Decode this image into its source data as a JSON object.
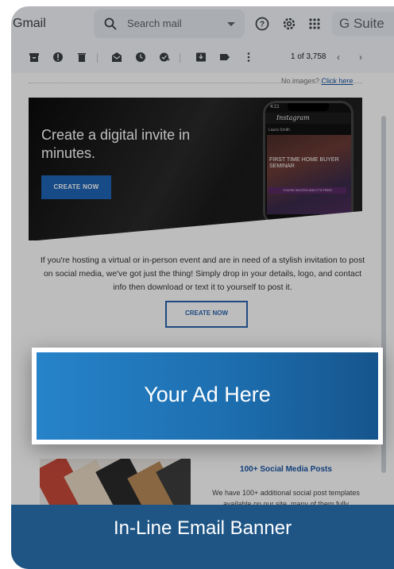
{
  "gmail": {
    "app_name": "Gmail",
    "search_placeholder": "Search mail",
    "gsuite_label": "G Suite",
    "pager": "1 of 3,758",
    "prev": "‹",
    "next": "›"
  },
  "email": {
    "no_images": "No images?",
    "click_here": "Click here",
    "hero_headline": "Create a digital invite in minutes.",
    "hero_cta": "CREATE NOW",
    "phone": {
      "time": "4:21",
      "app": "Instagram",
      "user": "Laura Smith",
      "post_title": "FIRST TIME HOME BUYER SEMINAR",
      "post_bar": "YOU'RE INVITED AND IT'S FREE!"
    },
    "paragraph": "If you're hosting a virtual or in-person event and are in need of a stylish invitation to post on social media, we've got just the thing! Simply drop in your details, logo, and contact info then download or text it to yourself to post it.",
    "cta": "CREATE NOW",
    "social_title": "100+ Social Media Posts",
    "social_text": "We have 100+ additional social post templates available on our site, many of them fully"
  },
  "overlay": {
    "ad_text": "Your Ad Here",
    "banner_text": "In-Line Email Banner"
  },
  "colors": {
    "accent_blue": "#1f66b8",
    "ad_blue_start": "#2783c9",
    "ad_blue_end": "#16558d",
    "banner_blue": "#1e5585"
  }
}
